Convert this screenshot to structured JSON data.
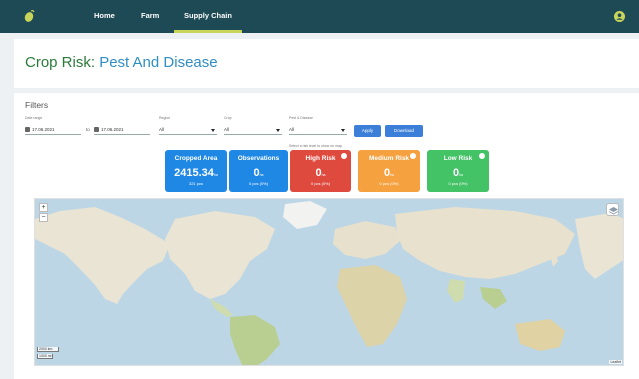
{
  "nav": {
    "items": [
      {
        "label": "Home"
      },
      {
        "label": "Farm"
      },
      {
        "label": "Supply Chain"
      }
    ],
    "active": "Supply Chain"
  },
  "page": {
    "title_prefix": "Crop Risk:",
    "title_subject": "Pest And Disease"
  },
  "filters": {
    "title": "Filters",
    "date_range_label": "Date range",
    "date_from": "17.06.2021",
    "to_label": "to",
    "date_to": "17.06.2021",
    "region_label": "Region",
    "region_value": "All",
    "crop_label": "Crop",
    "crop_value": "All",
    "pest_label": "Pest & Disease",
    "pest_value": "All",
    "apply_label": "Apply",
    "download_label": "Download",
    "hint": "Select a risk level to show on map"
  },
  "stats": {
    "cropped_area": {
      "label": "Cropped Area",
      "value": "2415.34",
      "unit": "ha",
      "sub": "321 pcs"
    },
    "observations": {
      "label": "Observations",
      "value": "0",
      "unit": "ha",
      "sub": "0 pcs (0%)"
    },
    "high_risk": {
      "label": "High Risk",
      "value": "0",
      "unit": "ha",
      "sub": "0 pcs (0%)"
    },
    "medium_risk": {
      "label": "Medium Risk",
      "value": "0",
      "unit": "ha",
      "sub": "0 pcs (0%)"
    },
    "low_risk": {
      "label": "Low Risk",
      "value": "0",
      "unit": "ha",
      "sub": "0 pcs (0%)"
    }
  },
  "map": {
    "zoom_in": "+",
    "zoom_out": "−",
    "scale_1": "2000 km",
    "scale_2": "1000 mi",
    "attribution": "Leaflet"
  },
  "colors": {
    "topbar": "#1d4a55",
    "accent": "#c9d45a",
    "title_green": "#2b7a3a",
    "title_blue": "#2f8ec6",
    "blue_card": "#1f88e5",
    "high": "#de4a3e",
    "medium": "#f6a13f",
    "low": "#43c266"
  },
  "icons": {
    "logo": "leaf-logo-icon",
    "user": "user-account-icon",
    "calendar": "calendar-icon",
    "layers": "layers-icon"
  }
}
